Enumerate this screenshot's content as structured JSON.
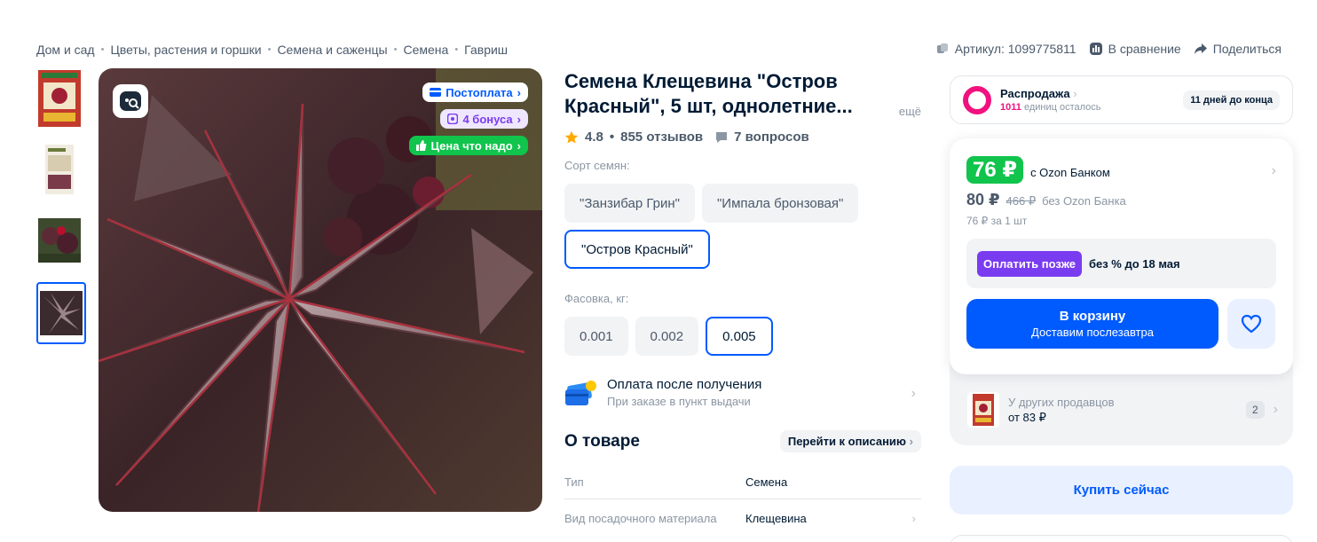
{
  "breadcrumb": [
    "Дом и сад",
    "Цветы, растения и горшки",
    "Семена и саженцы",
    "Семена",
    "Гавриш"
  ],
  "top_actions": {
    "article": "Артикул: 1099775811",
    "compare": "В сравнение",
    "share": "Поделиться"
  },
  "photo_badges": {
    "postpay": "Постоплата",
    "bonus": "4 бонуса",
    "price_ok": "Цена что надо"
  },
  "product": {
    "title": "Семена Клещевина \"Остров Красный\", 5 шт, однолетние...",
    "more": "ещё",
    "rating": "4.8",
    "reviews": "855 отзывов",
    "questions": "7 вопросов",
    "variety_label": "Сорт семян:",
    "varieties": [
      "\"Занзибар Грин\"",
      "\"Импала бронзовая\"",
      "\"Остров Красный\""
    ],
    "pack_label": "Фасовка, кг:",
    "packs": [
      "0.001",
      "0.002",
      "0.005"
    ],
    "pay_title": "Оплата после получения",
    "pay_sub": "При заказе в пункт выдачи",
    "about_title": "О товаре",
    "about_link": "Перейти к описанию",
    "specs": [
      {
        "k": "Тип",
        "v": "Семена"
      },
      {
        "k": "Вид посадочного материала",
        "v": "Клещевина"
      }
    ]
  },
  "sale": {
    "title": "Распродажа",
    "count": "1011",
    "left": "единиц осталось",
    "days": "11 дней до конца"
  },
  "price": {
    "ozon_price": "76 ₽",
    "ozon_bank": "с Ozon Банком",
    "regular": "80 ₽",
    "old": "466 ₽",
    "no_bank": "без Ozon Банка",
    "per_unit": "76 ₽ за 1 шт",
    "pay_later_tag": "Оплатить позже",
    "pay_later_text": "без % до 18 мая",
    "cart_title": "В корзину",
    "cart_sub": "Доставим послезавтра"
  },
  "other_sellers": {
    "title": "У других продавцов",
    "from": "от 83 ₽",
    "count": "2"
  },
  "buy_now": "Купить сейчас",
  "colors": {
    "accent": "#005bff",
    "green": "#10c44c",
    "purple": "#7a3cf0",
    "pink": "#f1117e"
  }
}
